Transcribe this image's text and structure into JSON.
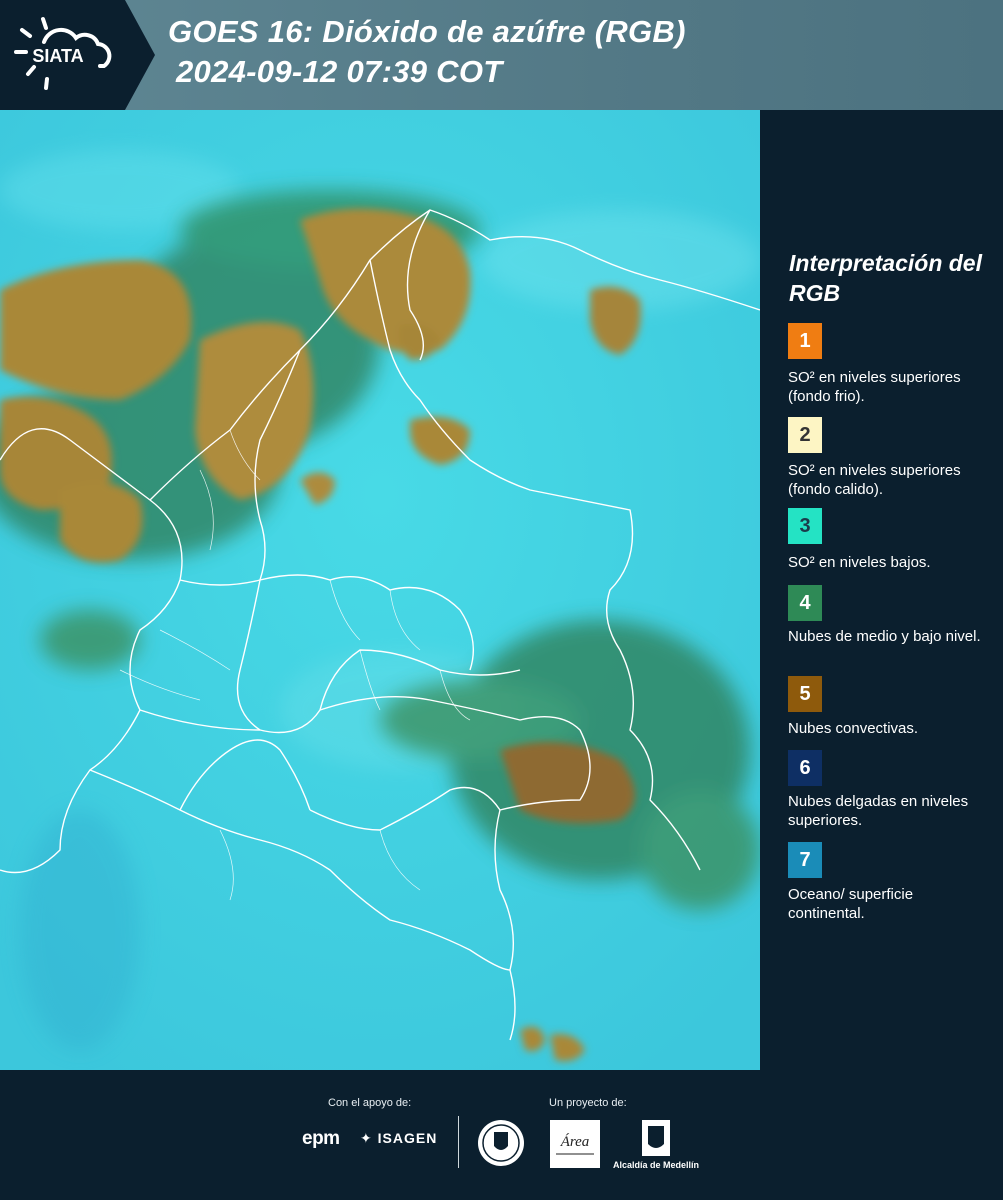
{
  "header": {
    "logo_text": "SIATA",
    "title_line1": "GOES 16: Dióxido de azúfre (RGB)",
    "title_line2": "2024-09-12 07:39 COT"
  },
  "legend": {
    "title": "Interpretación del RGB",
    "items": [
      {
        "number": "1",
        "color": "#f07d12",
        "description": "SO² en niveles superiores (fondo frio)."
      },
      {
        "number": "2",
        "color": "#fdf5c4",
        "description": "SO² en niveles superiores (fondo calido)."
      },
      {
        "number": "3",
        "color": "#24e3c4",
        "description": "SO² en niveles bajos."
      },
      {
        "number": "4",
        "color": "#2e8a56",
        "description": "Nubes de medio y bajo nivel."
      },
      {
        "number": "5",
        "color": "#8e5a0c",
        "description": "Nubes convectivas."
      },
      {
        "number": "6",
        "color": "#0e2f64",
        "description": "Nubes delgadas en niveles superiores."
      },
      {
        "number": "7",
        "color": "#1a8cb8",
        "description": "Oceano/ superficie continental."
      }
    ]
  },
  "footer": {
    "support_label": "Con el apoyo de:",
    "project_label": "Un proyecto de:",
    "epm": "epm",
    "isagen": "ISAGEN",
    "area_logo_text": "Área",
    "alcaldia": "Alcaldía de Medellín"
  }
}
